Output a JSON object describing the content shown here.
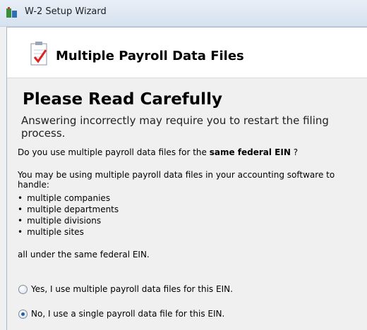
{
  "window": {
    "title": "W-2 Setup Wizard"
  },
  "header": {
    "title": "Multiple Payroll Data Files"
  },
  "content": {
    "heading": "Please Read Carefully",
    "subheading": "Answering incorrectly may require you to restart the filing process.",
    "question_prefix": "Do you use multiple payroll data files for the",
    "question_bold": "same federal EIN",
    "question_suffix": "?",
    "explanation": "You may be using multiple payroll data files in your accounting software to handle:",
    "bullets": [
      "multiple companies",
      "multiple departments",
      "multiple divisions",
      "multiple sites"
    ],
    "tail": "all under the same federal EIN."
  },
  "options": [
    {
      "label": "Yes, I use multiple payroll data files for this EIN.",
      "selected": false
    },
    {
      "label": "No, I use a single payroll data file for this EIN.",
      "selected": true
    }
  ]
}
